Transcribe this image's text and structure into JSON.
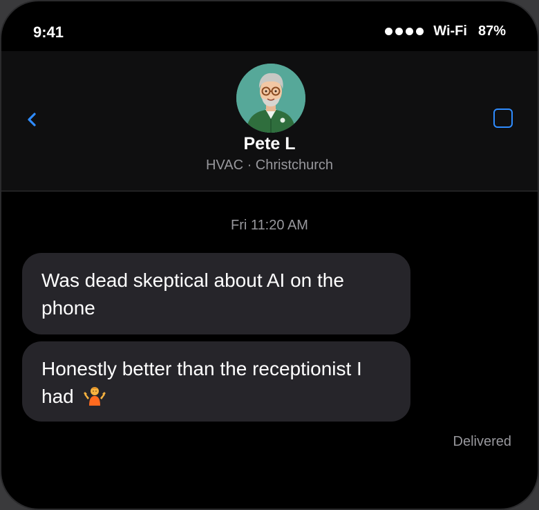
{
  "status_bar": {
    "time": "9:41",
    "network": "Wi-Fi",
    "battery": "87%"
  },
  "header": {
    "contact_name": "Pete L",
    "contact_subtitle": "HVAC · Christchurch",
    "back_icon": "chevron-left-icon",
    "action_icon": "square-icon",
    "accent_color": "#2f8cff"
  },
  "conversation": {
    "timestamp": "Fri 11:20 AM",
    "messages": [
      {
        "text": "Was dead skeptical about AI on the phone"
      },
      {
        "text": "Honestly better than the receptionist I had",
        "emoji": "person-shrugging-emoji"
      }
    ],
    "status": "Delivered"
  }
}
